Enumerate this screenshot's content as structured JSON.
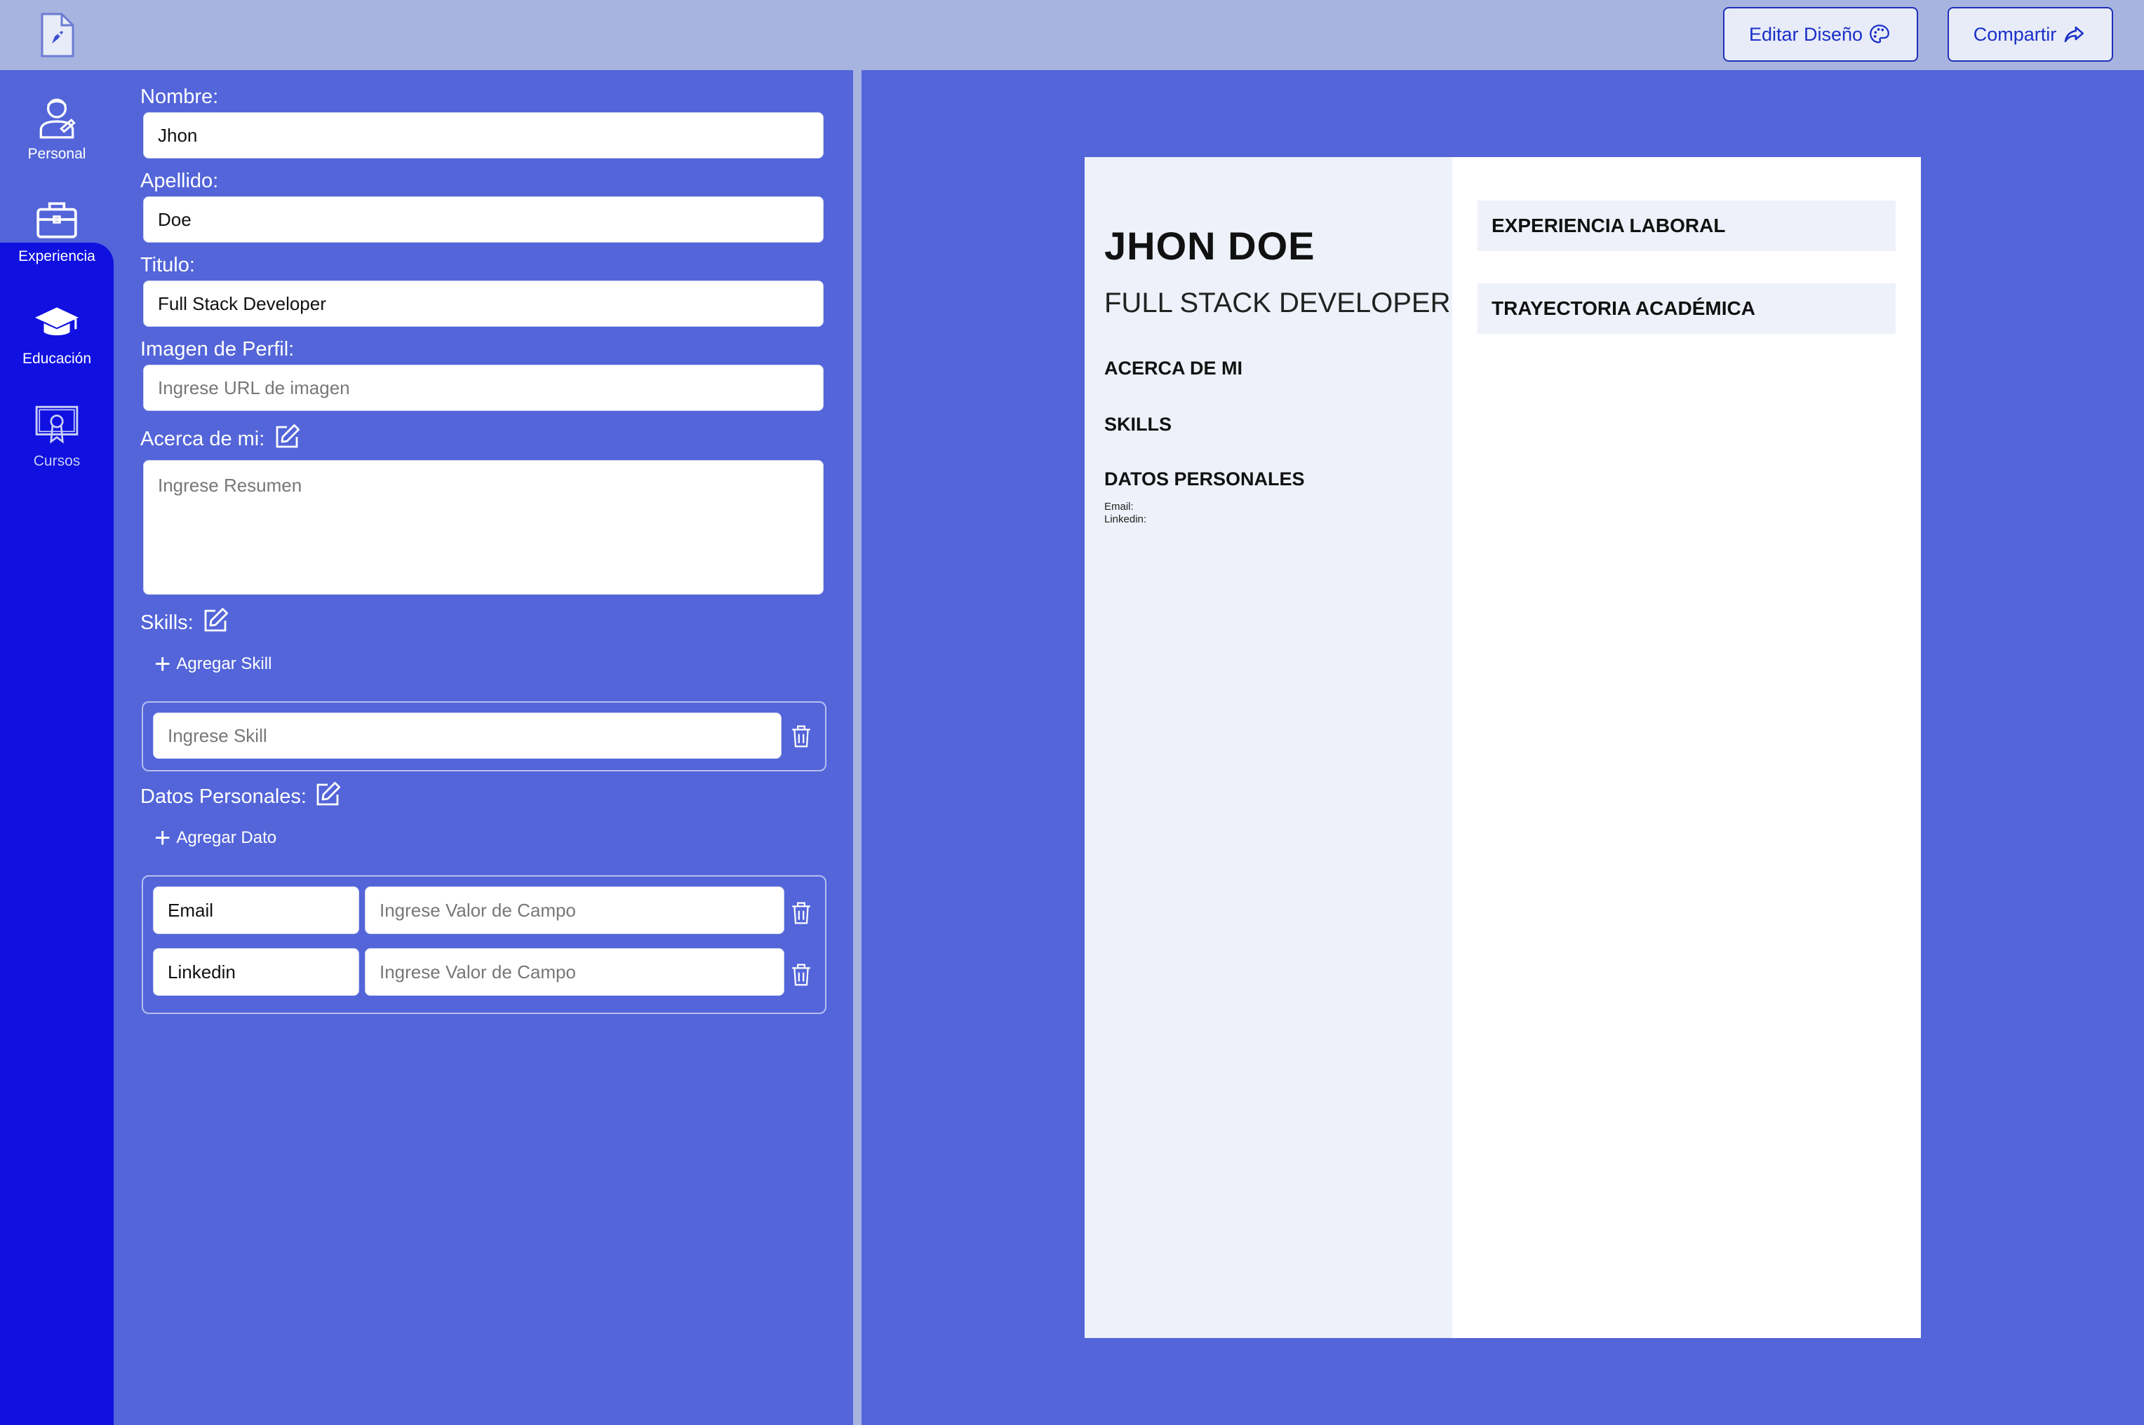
{
  "header": {
    "edit_design_label": "Editar Diseño",
    "share_label": "Compartir",
    "icons": {
      "logo": "rocket-document-icon",
      "edit": "palette-icon",
      "share": "share-arrow-icon"
    }
  },
  "sidebar": {
    "items": [
      {
        "label": "Personal",
        "icon": "person-icon"
      },
      {
        "label": "Experiencia",
        "icon": "briefcase-icon"
      },
      {
        "label": "Educación",
        "icon": "graduation-cap-icon"
      },
      {
        "label": "Cursos",
        "icon": "certificate-icon"
      }
    ]
  },
  "form": {
    "nombre_label": "Nombre:",
    "nombre_value": "Jhon",
    "apellido_label": "Apellido:",
    "apellido_value": "Doe",
    "titulo_label": "Titulo:",
    "titulo_value": "Full Stack Developer",
    "imagen_label": "Imagen de Perfil:",
    "imagen_placeholder": "Ingrese URL de imagen",
    "acerca_label": "Acerca de mi:",
    "acerca_placeholder": "Ingrese Resumen",
    "skills_label": "Skills:",
    "add_skill_label": "Agregar Skill",
    "skill_placeholder": "Ingrese Skill",
    "datos_label": "Datos Personales:",
    "add_dato_label": "Agregar Dato",
    "datos_rows": [
      {
        "field": "Email",
        "value_placeholder": "Ingrese Valor de Campo"
      },
      {
        "field": "Linkedin",
        "value_placeholder": "Ingrese Valor de Campo"
      }
    ]
  },
  "preview": {
    "name": "JHON DOE",
    "title": "FULL STACK DEVELOPER",
    "acerca_heading": "ACERCA DE MI",
    "skills_heading": "SKILLS",
    "datos_heading": "DATOS PERSONALES",
    "datos_lines": [
      "Email:",
      "Linkedin:"
    ],
    "experiencia_heading": "EXPERIENCIA LABORAL",
    "trayectoria_heading": "TRAYECTORIA ACADÉMICA"
  },
  "colors": {
    "background": "#5365d9",
    "topbar": "#a8b4e0",
    "sidebar_active": "#1010e0",
    "button_text": "#1a2fc8"
  }
}
